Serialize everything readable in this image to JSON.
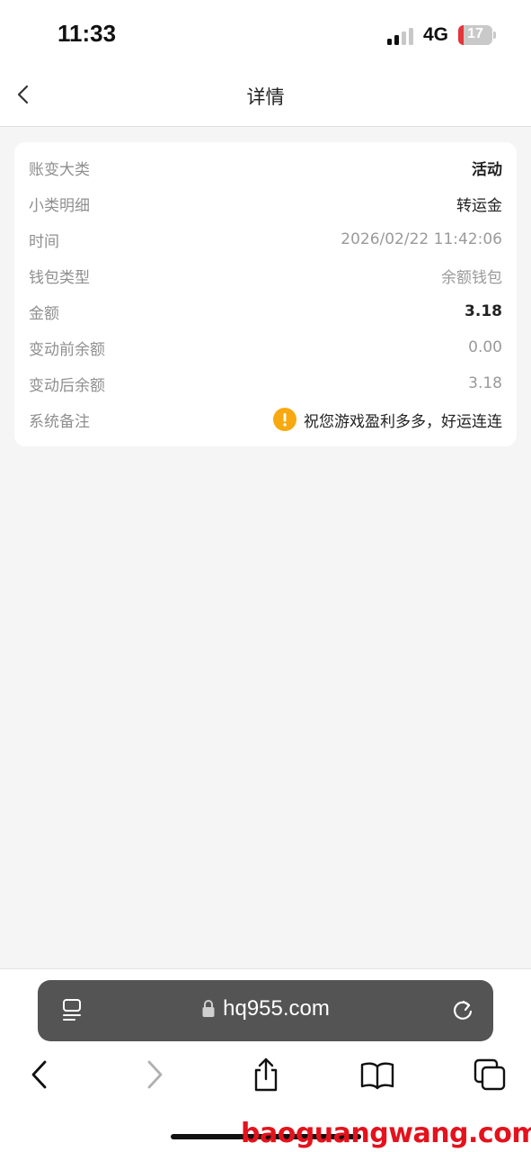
{
  "status_bar": {
    "time": "11:33",
    "network": "4G",
    "battery_percent": "17"
  },
  "nav": {
    "title": "详情",
    "back_icon": "chevron-left-icon"
  },
  "details": [
    {
      "label": "账变大类",
      "value": "活动",
      "style": "bold"
    },
    {
      "label": "小类明细",
      "value": "转运金",
      "style": "dark"
    },
    {
      "label": "时间",
      "value": "2026/02/22 11:42:06",
      "style": "muted"
    },
    {
      "label": "钱包类型",
      "value": "余额钱包",
      "style": "muted"
    },
    {
      "label": "金额",
      "value": "3.18",
      "style": "bold"
    },
    {
      "label": "变动前余额",
      "value": "0.00",
      "style": "muted"
    },
    {
      "label": "变动后余额",
      "value": "3.18",
      "style": "muted"
    },
    {
      "label": "系统备注",
      "value": "祝您游戏盈利多多，好运连连",
      "style": "dark",
      "icon": "warning-icon"
    }
  ],
  "browser": {
    "url": "hq955.com",
    "icons": [
      "tab-list-icon",
      "lock-icon",
      "reload-icon"
    ],
    "toolbar": [
      "back-icon",
      "forward-icon",
      "share-icon",
      "bookmarks-icon",
      "tabs-icon"
    ]
  },
  "watermark": "baoguangwang.com",
  "colors": {
    "warning": "#f7a90f",
    "battery_low": "#e5343a",
    "watermark": "#e4121c",
    "url_bar": "#545454"
  }
}
